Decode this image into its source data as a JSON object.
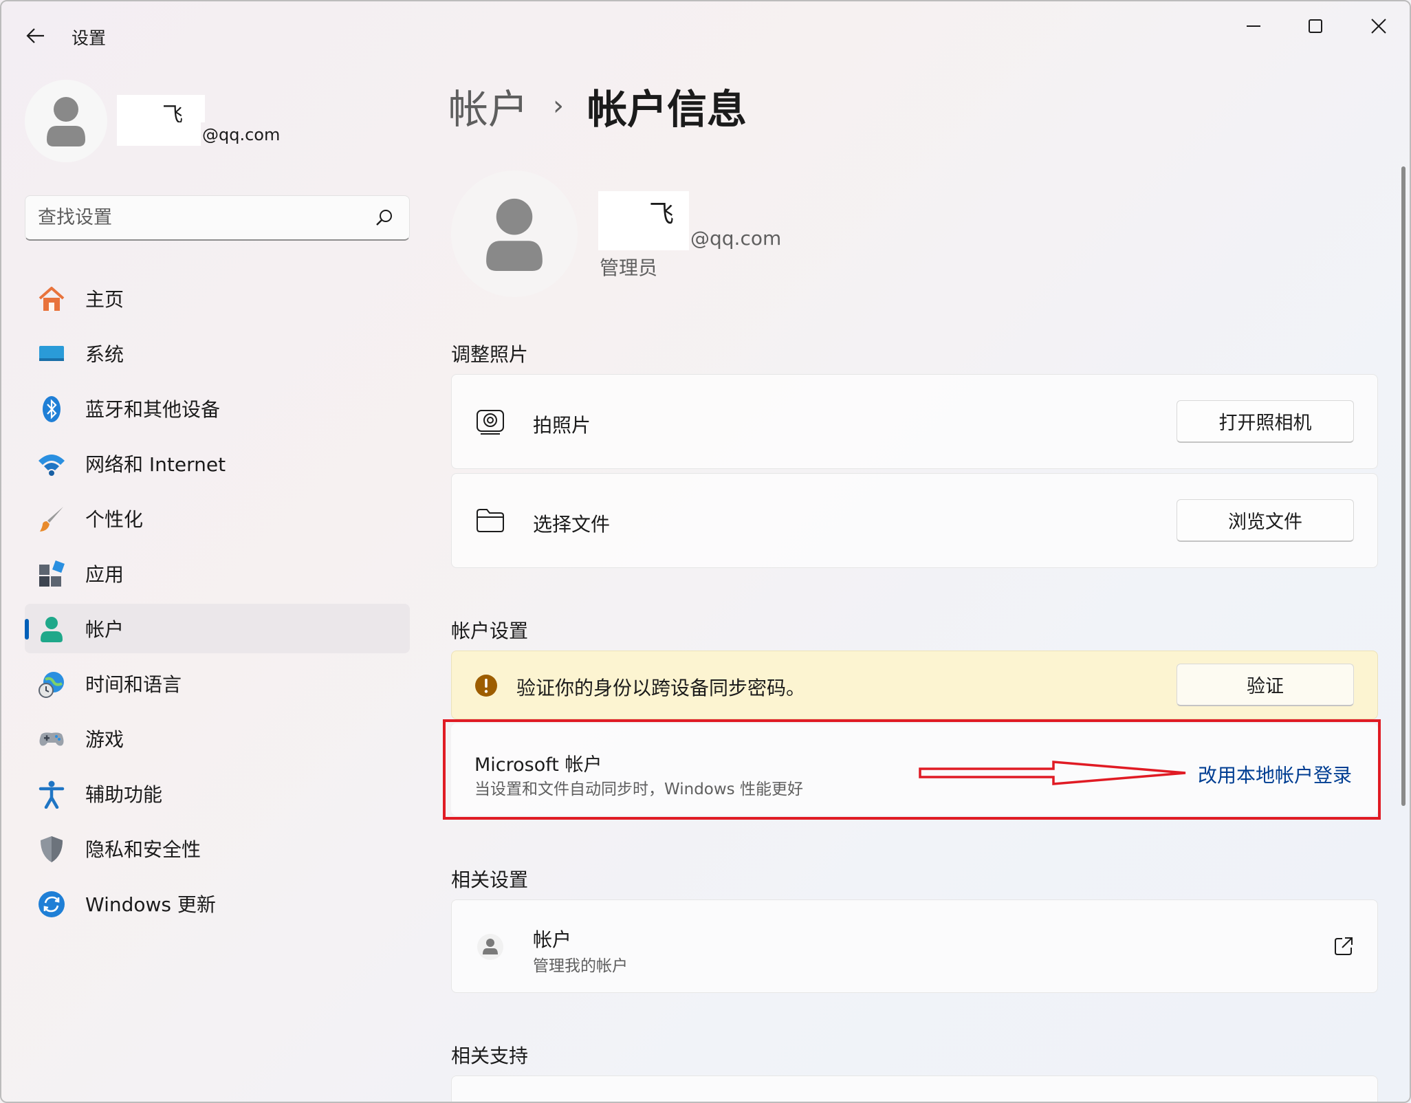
{
  "window": {
    "title": "设置",
    "controls": {
      "minimize": "minimize-icon",
      "maximize": "maximize-icon",
      "close": "close-icon"
    }
  },
  "sidebar": {
    "user": {
      "name": "飞",
      "email": "@qq.com"
    },
    "search": {
      "placeholder": "查找设置"
    },
    "items": [
      {
        "label": "主页",
        "icon": "home-icon"
      },
      {
        "label": "系统",
        "icon": "system-icon"
      },
      {
        "label": "蓝牙和其他设备",
        "icon": "bluetooth-icon"
      },
      {
        "label": "网络和 Internet",
        "icon": "wifi-icon"
      },
      {
        "label": "个性化",
        "icon": "brush-icon"
      },
      {
        "label": "应用",
        "icon": "apps-icon"
      },
      {
        "label": "帐户",
        "icon": "account-icon",
        "active": true
      },
      {
        "label": "时间和语言",
        "icon": "globe-clock-icon"
      },
      {
        "label": "游戏",
        "icon": "gamepad-icon"
      },
      {
        "label": "辅助功能",
        "icon": "accessibility-icon"
      },
      {
        "label": "隐私和安全性",
        "icon": "shield-icon"
      },
      {
        "label": "Windows 更新",
        "icon": "update-icon"
      }
    ]
  },
  "main": {
    "breadcrumb": {
      "parent": "帐户",
      "separator": "›",
      "current": "帐户信息"
    },
    "account": {
      "name": "飞",
      "email": "@qq.com",
      "role": "管理员"
    },
    "photo_section": {
      "title": "调整照片",
      "rows": [
        {
          "label": "拍照片",
          "button": "打开照相机",
          "icon": "camera-icon"
        },
        {
          "label": "选择文件",
          "button": "浏览文件",
          "icon": "folder-icon"
        }
      ]
    },
    "account_settings": {
      "title": "帐户设置",
      "warning": {
        "text": "验证你的身份以跨设备同步密码。",
        "button": "验证",
        "icon": "warning-icon",
        "color": "#9d5d00"
      },
      "microsoft": {
        "title": "Microsoft 帐户",
        "subtitle": "当设置和文件自动同步时，Windows 性能更好",
        "link": "改用本地帐户登录"
      }
    },
    "related_settings": {
      "title": "相关设置",
      "rows": [
        {
          "title": "帐户",
          "subtitle": "管理我的帐户",
          "icon": "person-icon",
          "action_icon": "external-link-icon"
        }
      ]
    },
    "related_support": {
      "title": "相关支持"
    }
  },
  "colors": {
    "accent": "#005fb8",
    "link": "#003e92",
    "highlight": "#e01b24",
    "warning_bg": "#fcf4d1"
  }
}
